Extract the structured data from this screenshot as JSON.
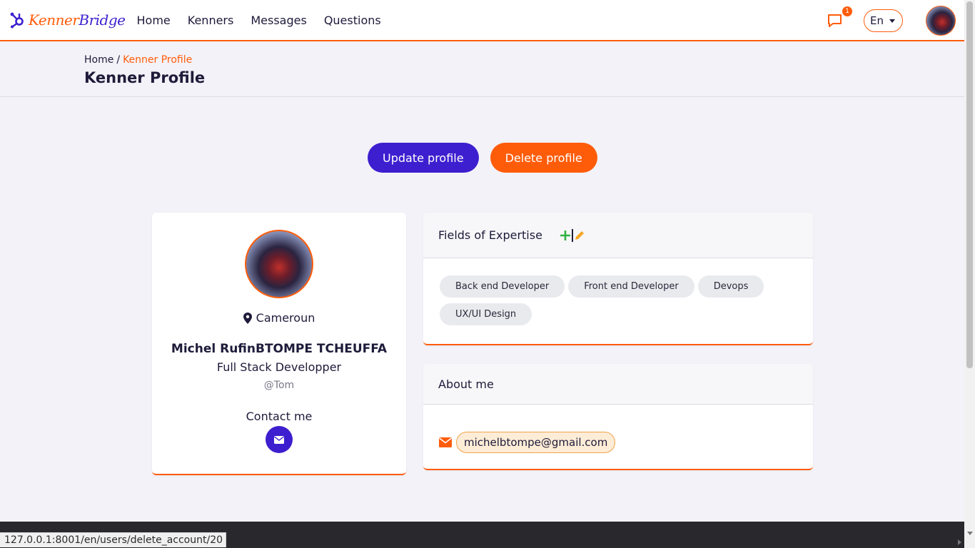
{
  "header": {
    "logo_kenner": "Kenner",
    "logo_bridge": "Bridge",
    "nav": [
      "Home",
      "Kenners",
      "Messages",
      "Questions"
    ],
    "message_badge": "1",
    "language": "En"
  },
  "breadcrumb": {
    "home": "Home",
    "separator": "/",
    "current": "Kenner Profile"
  },
  "page_title": "Kenner Profile",
  "actions": {
    "update": "Update profile",
    "delete": "Delete profile"
  },
  "profile": {
    "location": "Cameroun",
    "name": "Michel RufinBTOMPE TCHEUFFA",
    "title": "Full Stack Developper",
    "handle": "@Tom",
    "contact_label": "Contact me"
  },
  "expertise": {
    "heading": "Fields of Expertise",
    "tags": [
      "Back end Developer",
      "Front end Developer",
      "Devops",
      "UX/UI Design"
    ]
  },
  "about": {
    "heading": "About me",
    "email": "michelbtompe@gmail.com"
  },
  "status_bar": {
    "url": "127.0.0.1:8001/en/users/delete_account/20"
  },
  "colors": {
    "primary": "#3d1fcf",
    "accent": "#ff5c0a",
    "background": "#f3f2f8",
    "footer": "#29282d"
  },
  "icons": [
    "logo-hub-icon",
    "message-icon",
    "caret-down-icon",
    "map-marker-icon",
    "envelope-icon",
    "plus-icon",
    "pencil-icon"
  ]
}
